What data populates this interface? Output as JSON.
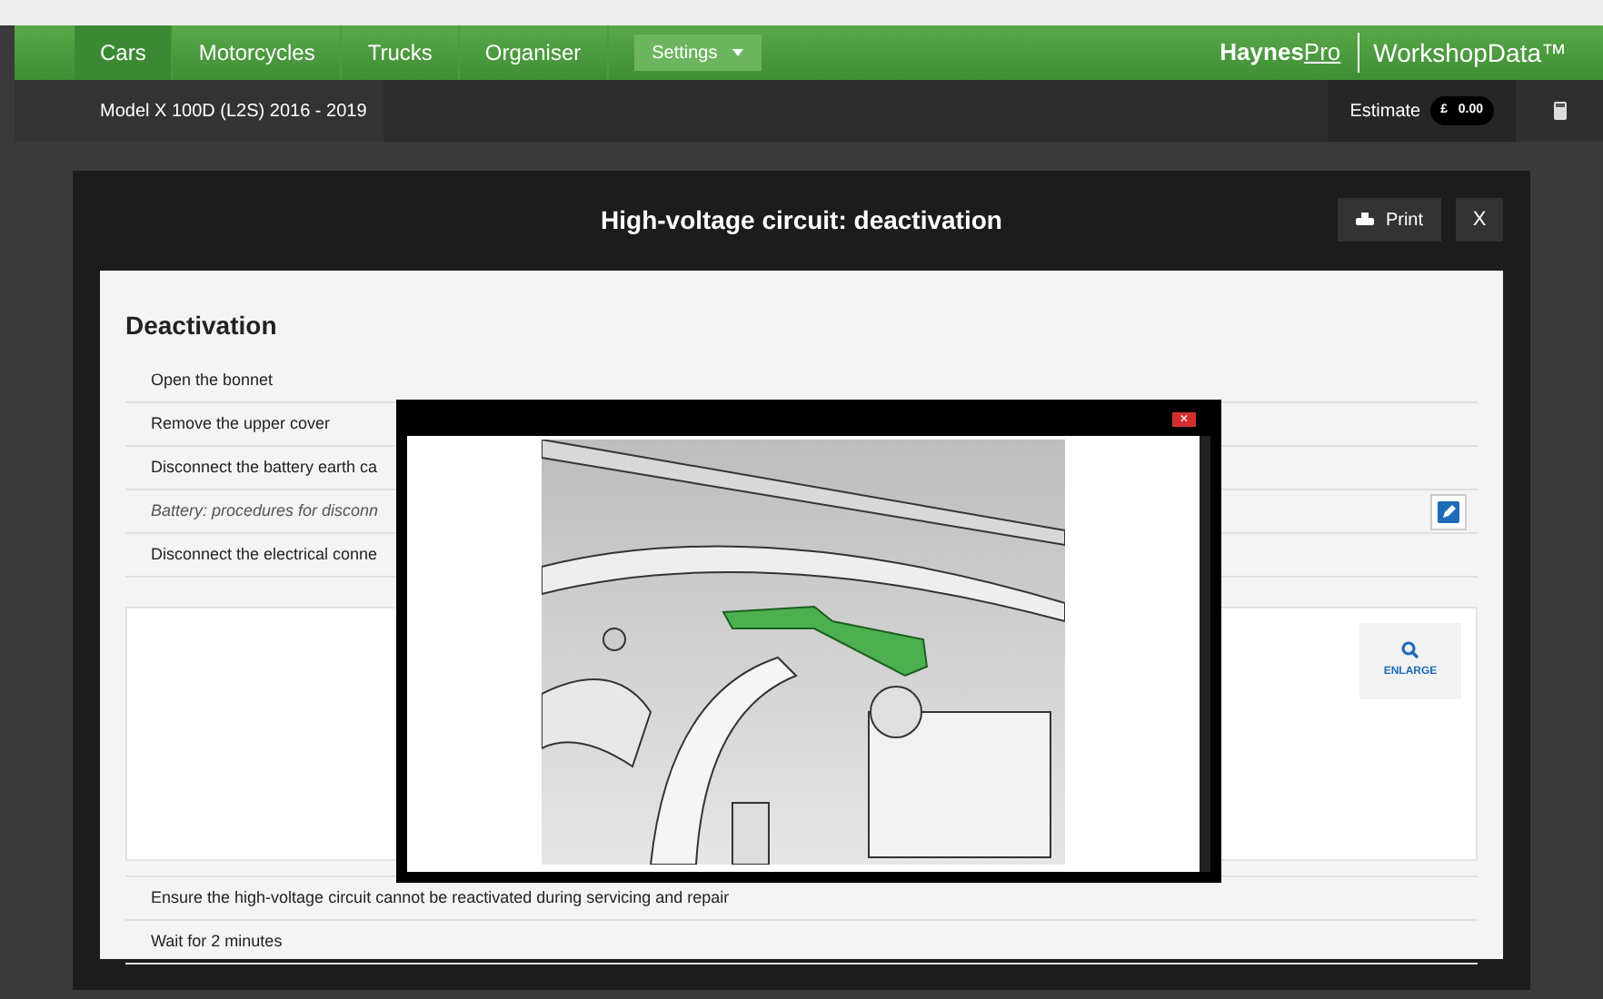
{
  "nav": {
    "tabs": [
      {
        "label": "Cars",
        "selected": true
      },
      {
        "label": "Motorcycles",
        "selected": false
      },
      {
        "label": "Trucks",
        "selected": false
      },
      {
        "label": "Organiser",
        "selected": false
      }
    ],
    "settings": "Settings",
    "brand": {
      "part1": "Haynes",
      "part2": "Pro",
      "product": "WorkshopData™"
    }
  },
  "vehicle_bar": {
    "model": "Model X 100D (L2S) 2016 - 2019",
    "estimate_label": "Estimate",
    "currency": "£",
    "amount": "0.00"
  },
  "modal": {
    "title": "High-voltage circuit: deactivation",
    "print": "Print",
    "close": "X",
    "section": "Deactivation",
    "steps_before": [
      {
        "kind": "step",
        "text": "Open the bonnet"
      },
      {
        "kind": "step",
        "text": "Remove the upper cover"
      },
      {
        "kind": "step",
        "text": "Disconnect the battery earth ca"
      },
      {
        "kind": "link",
        "text": "Battery: procedures for disconn"
      },
      {
        "kind": "step",
        "text": "Disconnect the electrical conne"
      }
    ],
    "enlarge": "ENLARGE",
    "steps_after": [
      {
        "text": "Ensure the high-voltage circuit cannot be reactivated during servicing and repair"
      },
      {
        "text": "Wait for 2 minutes"
      }
    ]
  },
  "popup": {
    "close": "×"
  }
}
